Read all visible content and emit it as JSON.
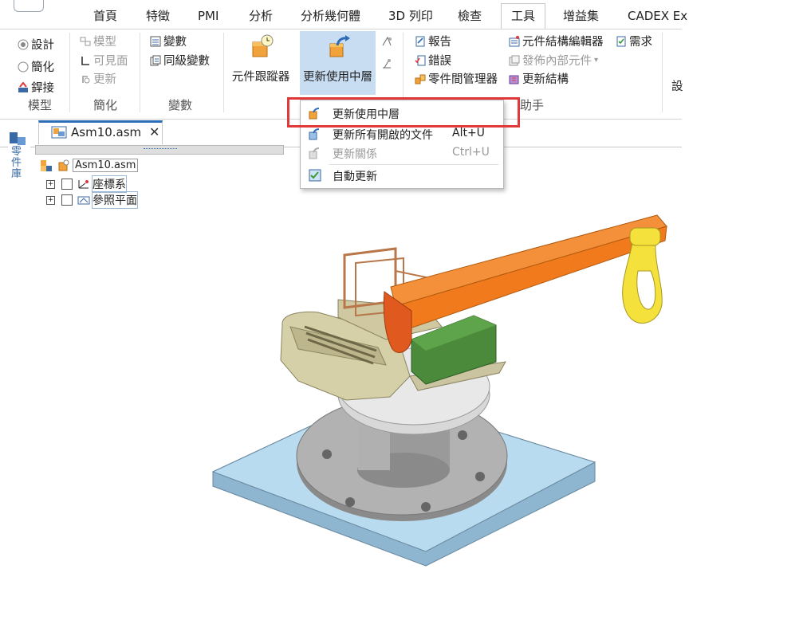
{
  "tabs": [
    {
      "label": "首頁"
    },
    {
      "label": "特徵"
    },
    {
      "label": "PMI"
    },
    {
      "label": "分析"
    },
    {
      "label": "分析幾何體"
    },
    {
      "label": "3D 列印"
    },
    {
      "label": "檢查"
    },
    {
      "label": "工具"
    },
    {
      "label": "增益集"
    },
    {
      "label": "CADEX Ex"
    }
  ],
  "ribbon": {
    "model": {
      "design": "設計",
      "simplify": "簡化",
      "weld": "銲接",
      "group": "模型"
    },
    "simplify_grp": {
      "model": "模型",
      "visible": "可見面",
      "update": "更新",
      "group": "簡化"
    },
    "variables": {
      "vars": "變數",
      "peer": "同級變數",
      "group": "變數"
    },
    "tracker": {
      "label": "元件跟蹤器"
    },
    "update_where_used": {
      "label": "更新使用中層"
    },
    "assistant": {
      "report": "報告",
      "errors": "錯誤",
      "part_manager": "零件間管理器",
      "group": "助手"
    },
    "structure": {
      "editor": "元件結構編輯器",
      "publish": "發佈內部元件",
      "update": "更新結構"
    },
    "requirements": {
      "label": "需求"
    },
    "cut_label": "設"
  },
  "menu": {
    "items": [
      {
        "label": "更新使用中層",
        "shortcut": ""
      },
      {
        "label": "更新所有開啟的文件",
        "shortcut": "Alt+U"
      },
      {
        "label": "更新關係",
        "shortcut": "Ctrl+U"
      },
      {
        "label": "自動更新",
        "shortcut": ""
      }
    ]
  },
  "document": {
    "tab_title": "Asm10.asm",
    "close": "✕"
  },
  "sidebar": {
    "label": "零件庫"
  },
  "tree": {
    "root": "Asm10.asm",
    "items": [
      {
        "label": "座標系"
      },
      {
        "label": "參照平面"
      }
    ]
  },
  "colors": {
    "accent": "#2d6db5",
    "highlight": "#e0393a",
    "select": "#c8dcf2",
    "base_plate": "#a7cfe8",
    "arm": "#f2801f",
    "hook": "#f4e13c"
  }
}
